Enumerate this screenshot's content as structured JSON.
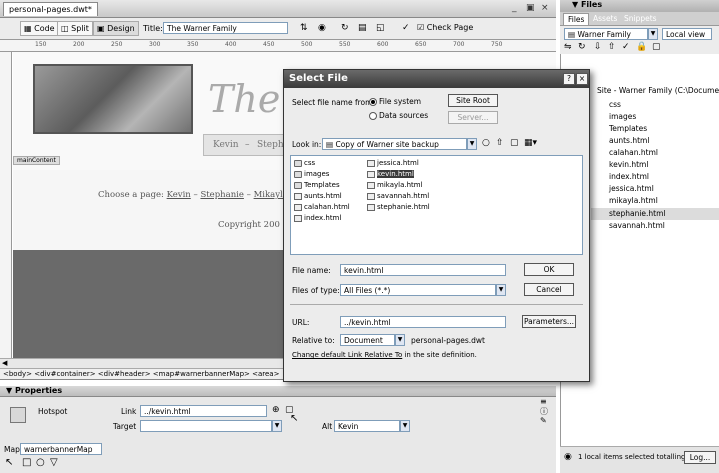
{
  "document": {
    "tab": "personal-pages.dwt*",
    "window_controls": [
      "_",
      "×"
    ],
    "toolbar": {
      "code": "Code",
      "split": "Split",
      "design": "Design",
      "title_label": "Title:",
      "title_value": "The Warner Family",
      "check_page": "Check Page"
    },
    "ruler_marks": [
      "150",
      "200",
      "250",
      "300",
      "350",
      "400",
      "450",
      "500",
      "550",
      "600",
      "650",
      "700",
      "750"
    ],
    "page": {
      "script_title": "The",
      "nav_kevin": "Kevin",
      "nav_dash": "–",
      "nav_partial": "Steph",
      "maincontent_tag": "mainContent",
      "choose_prefix": "Choose a page:",
      "choose_kevin": "Kevin",
      "choose_dash1": "–",
      "choose_stephanie": "Stephanie",
      "choose_dash2": "–",
      "choose_mikayla": "Mikayla",
      "copyright": "Copyright 200"
    },
    "tag_selector": "<body> <div#container> <div#header> <map#warnerbannerMap> <area>"
  },
  "properties": {
    "header": "▼ Properties",
    "hotspot_label": "Hotspot",
    "link_label": "Link",
    "link_value": "../kevin.html",
    "target_label": "Target",
    "alt_label": "Alt",
    "alt_value": "Kevin",
    "map_label": "Map",
    "map_value": "warnerbannerMap"
  },
  "files_panel": {
    "header": "▼ Files",
    "tabs": [
      "Files",
      "Assets",
      "Snippets"
    ],
    "site_select": "Warner Family",
    "view_select": "Local view",
    "tree_root": "Site - Warner Family (C:\\Documents",
    "items": [
      "css",
      "images",
      "Templates",
      "aunts.html",
      "calahan.html",
      "kevin.html",
      "index.html",
      "jessica.html",
      "mikayla.html",
      "stephanie.html",
      "savannah.html"
    ],
    "selected_item": "stephanie.html",
    "status": "1 local items selected totalling",
    "log_button": "Log..."
  },
  "dialog": {
    "title": "Select File",
    "select_from_label": "Select file name from:",
    "opt_file_system": "File system",
    "opt_data_sources": "Data sources",
    "site_root_button": "Site Root",
    "server_button": "Server...",
    "look_in_label": "Look in:",
    "look_in_value": "Copy of Warner site backup",
    "files_col1": [
      "css",
      "images",
      "Templates",
      "aunts.html",
      "calahan.html",
      "index.html"
    ],
    "files_col2": [
      "jessica.html",
      "kevin.html",
      "mikayla.html",
      "savannah.html",
      "stephanie.html"
    ],
    "selected_file": "kevin.html",
    "file_name_label": "File name:",
    "file_name_value": "kevin.html",
    "ok_button": "OK",
    "files_of_type_label": "Files of type:",
    "files_of_type_value": "All Files (*.*)",
    "cancel_button": "Cancel",
    "url_label": "URL:",
    "url_value": "../kevin.html",
    "parameters_button": "Parameters...",
    "relative_to_label": "Relative to:",
    "relative_to_value": "Document",
    "relative_doc": "personal-pages.dwt",
    "change_link": "Change default Link Relative To",
    "change_link_suffix": " in the site definition.",
    "help_glyph": "?",
    "close_glyph": "×"
  }
}
